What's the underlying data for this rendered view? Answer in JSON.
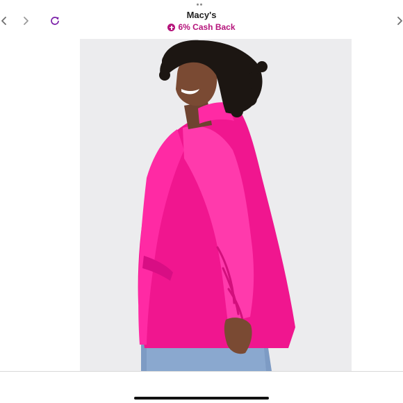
{
  "browser": {
    "site_title": "Macy's",
    "cashback_label": "6% Cash Back",
    "icons": {
      "back": "chevron-left-icon",
      "forward": "chevron-right-icon",
      "reload": "reload-icon",
      "more": "chevron-right-icon",
      "cashback": "plus-circle-icon",
      "grabber": "more-dots-icon"
    }
  },
  "product": {
    "image_subject": "model-wearing-blazer-photo"
  },
  "colors": {
    "brand_accent": "#b5147b",
    "blazer": "#ff1f9a",
    "image_background": "#ececee",
    "title_text": "#222222"
  }
}
